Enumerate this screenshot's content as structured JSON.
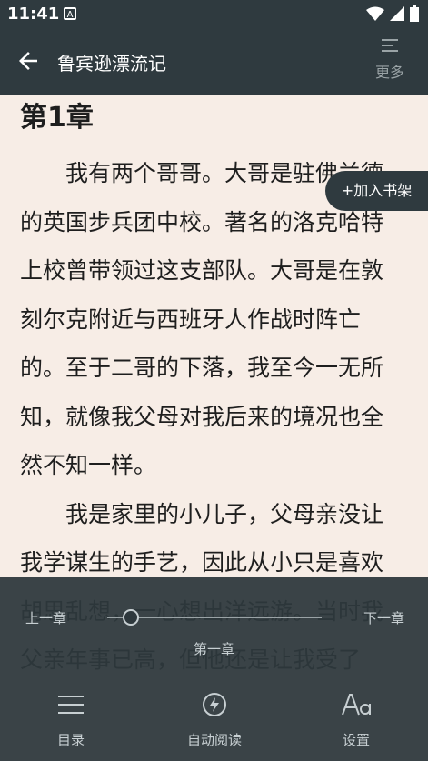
{
  "status": {
    "time": "11:41",
    "notif": "A"
  },
  "appbar": {
    "title": "鲁宾逊漂流记",
    "more_label": "更多"
  },
  "reader": {
    "chapter_title": "第1章",
    "paragraphs": [
      "我有两个哥哥。大哥是驻佛兰德的英国步兵团中校。著名的洛克哈特上校曾带领过这支部队。大哥是在敦刻尔克附近与西班牙人作战时阵亡的。至于二哥的下落，我至今一无所知，就像我父母对我后来的境况也全然不知一样。",
      "我是家里的小儿子，父母亲没让我学谋生的手艺，因此从小只是喜欢胡思乱想，一心想出洋远游。当时我父亲年事已高，但他还是让我受了"
    ]
  },
  "add_shelf": "+加入书架",
  "bottom": {
    "prev": "上一章",
    "next": "下一章",
    "chapter_name": "第一章",
    "progress": 0.11,
    "tabs": {
      "toc": "目录",
      "auto": "自动阅读",
      "settings": "设置"
    }
  }
}
